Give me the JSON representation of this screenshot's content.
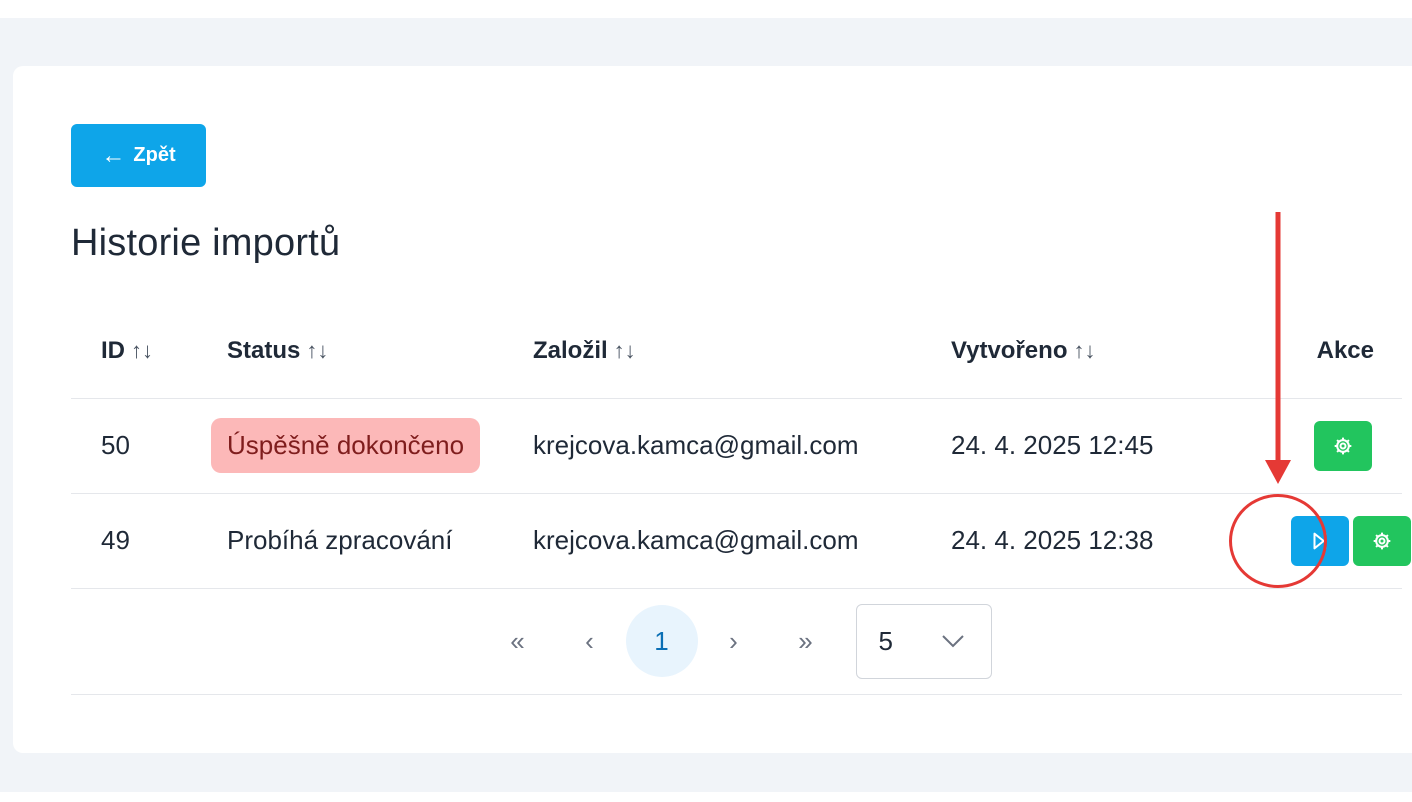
{
  "back_button": {
    "label": "Zpět",
    "icon": "arrow-left-icon"
  },
  "page_title": "Historie importů",
  "table": {
    "columns": [
      {
        "label": "ID",
        "sortable": true
      },
      {
        "label": "Status",
        "sortable": true
      },
      {
        "label": "Založil",
        "sortable": true
      },
      {
        "label": "Vytvořeno",
        "sortable": true
      },
      {
        "label": "Akce",
        "sortable": false
      }
    ],
    "sort_icon": "↑↓",
    "rows": [
      {
        "id": "50",
        "status": "Úspěšně dokončeno",
        "status_highlighted": true,
        "user": "krejcova.kamca@gmail.com",
        "created": "24. 4. 2025 12:45",
        "actions": [
          "settings-icon"
        ]
      },
      {
        "id": "49",
        "status": "Probíhá zpracování",
        "status_highlighted": false,
        "user": "krejcova.kamca@gmail.com",
        "created": "24. 4. 2025 12:38",
        "actions": [
          "skip-forward-icon",
          "settings-icon"
        ]
      }
    ]
  },
  "pagination": {
    "first": "«",
    "prev": "‹",
    "current_page": "1",
    "next": "›",
    "last": "»",
    "page_size": "5"
  },
  "colors": {
    "primary": "#0ea5e9",
    "success": "#22c55e",
    "badge_bg": "#fcb8b8",
    "annotation": "#e53935"
  }
}
